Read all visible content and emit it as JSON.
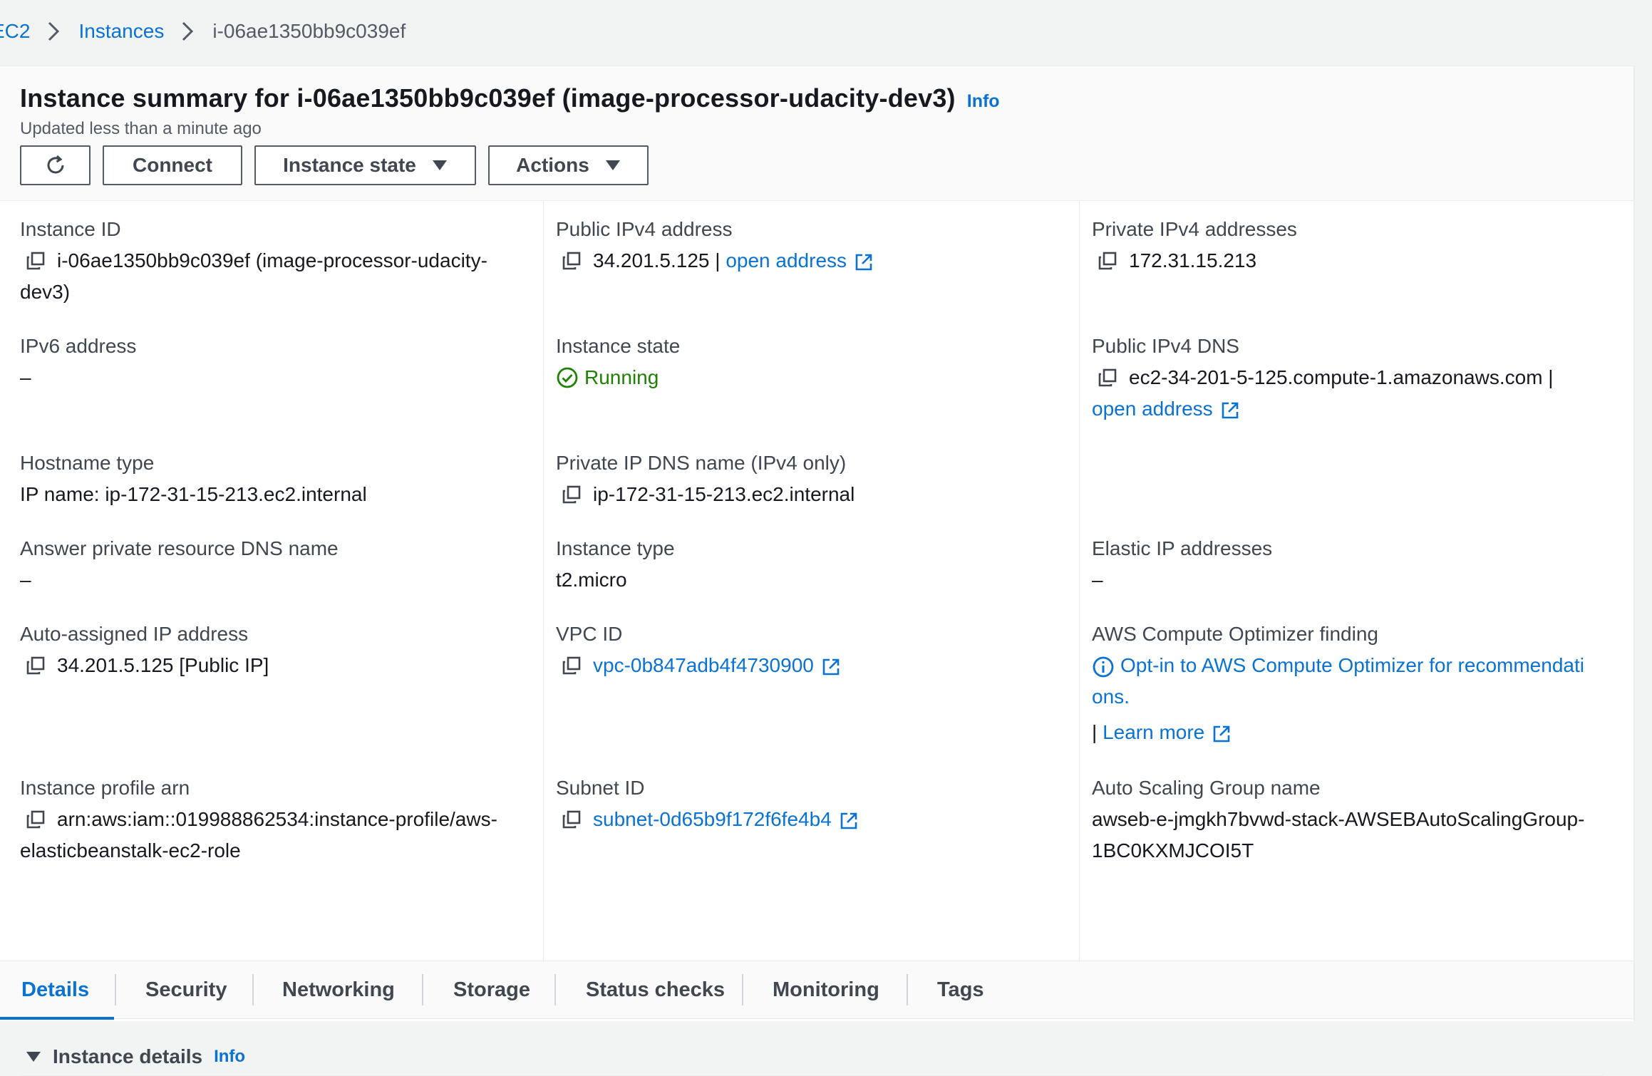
{
  "breadcrumb": {
    "root": "EC2",
    "instances": "Instances",
    "current": "i-06ae1350bb9c039ef"
  },
  "header": {
    "title": "Instance summary for i-06ae1350bb9c039ef (image-processor-udacity-dev3)",
    "info": "Info",
    "updated": "Updated less than a minute ago",
    "buttons": {
      "refresh_icon": "refresh-icon",
      "connect": "Connect",
      "instance_state": "Instance state",
      "actions": "Actions"
    }
  },
  "summary": {
    "instance_id": {
      "label": "Instance ID",
      "value": "i-06ae1350bb9c039ef (image-processor-udacity-",
      "value2": "dev3)"
    },
    "public_ipv4": {
      "label": "Public IPv4 address",
      "value": "34.201.5.125 | ",
      "link": "open address"
    },
    "private_ipv4": {
      "label": "Private IPv4 addresses",
      "value": "172.31.15.213"
    },
    "ipv6": {
      "label": "IPv6 address",
      "value": "–"
    },
    "instance_state": {
      "label": "Instance state",
      "value": "Running"
    },
    "public_dns": {
      "label": "Public IPv4 DNS",
      "value": "ec2-34-201-5-125.compute-1.amazonaws.com |",
      "link": "open address"
    },
    "hostname_type": {
      "label": "Hostname type",
      "value": "IP name: ip-172-31-15-213.ec2.internal"
    },
    "private_dns": {
      "label": "Private IP DNS name (IPv4 only)",
      "value": "ip-172-31-15-213.ec2.internal"
    },
    "answer_dns": {
      "label": "Answer private resource DNS name",
      "value": "–"
    },
    "instance_type": {
      "label": "Instance type",
      "value": "t2.micro"
    },
    "elastic_ip": {
      "label": "Elastic IP addresses",
      "value": "–"
    },
    "auto_ip": {
      "label": "Auto-assigned IP address",
      "value": "34.201.5.125 [Public IP]"
    },
    "vpc_id": {
      "label": "VPC ID",
      "value": "vpc-0b847adb4f4730900"
    },
    "optimizer": {
      "label": "AWS Compute Optimizer finding",
      "line1": "Opt-in to AWS Compute Optimizer for recommendati",
      "line2": "ons.",
      "separator": "| ",
      "learn_more": "Learn more"
    },
    "profile_arn": {
      "label": "Instance profile arn",
      "value": "arn:aws:iam::019988862534:instance-profile/aws-",
      "value2": "elasticbeanstalk-ec2-role"
    },
    "subnet_id": {
      "label": "Subnet ID",
      "value": "subnet-0d65b9f172f6fe4b4"
    },
    "asg_name": {
      "label": "Auto Scaling Group name",
      "value": "awseb-e-jmgkh7bvwd-stack-AWSEBAutoScalingGroup-",
      "value2": "1BC0KXMJCOI5T"
    }
  },
  "tabs": [
    "Details",
    "Security",
    "Networking",
    "Storage",
    "Status checks",
    "Monitoring",
    "Tags"
  ],
  "active_tab": "Details",
  "details_section": {
    "title": "Instance details",
    "info": "Info"
  },
  "colors": {
    "link": "#0972d3",
    "success": "#1d8102",
    "text": "#16191f",
    "muted": "#545b64"
  }
}
